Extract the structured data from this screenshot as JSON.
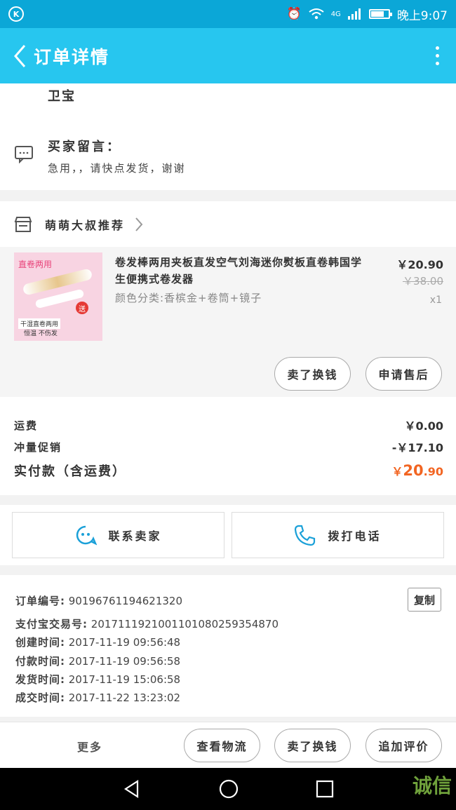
{
  "status_bar": {
    "time": "晚上9:07",
    "network": "4G"
  },
  "nav": {
    "title": "订单详情"
  },
  "address": {
    "name": "卫宝"
  },
  "buyer_message": {
    "title": "买家留言：",
    "text": "急用，，请快点发货，谢谢"
  },
  "shop": {
    "name": "萌萌大叔推荐"
  },
  "item": {
    "title": "卷发棒两用夹板直发空气刘海迷你熨板直卷韩国学生便携式卷发器",
    "sku": "颜色分类:香槟金+卷筒+镜子",
    "price": "￥20.90",
    "original_price": "￥38.00",
    "quantity": "x1",
    "image_label": "直卷两用",
    "image_caption1": "干湿直卷两用",
    "image_caption2": "恒温 不伤发",
    "buttons": [
      "卖了换钱",
      "申请售后"
    ]
  },
  "fees": {
    "shipping_label": "运费",
    "shipping_value": "￥0.00",
    "promo_label": "冲量促销",
    "promo_value": "-￥17.10",
    "total_label": "实付款（含运费）",
    "total_symbol": "￥",
    "total_int": "20",
    "total_dec": ".90"
  },
  "contact": {
    "seller_label": "联系卖家",
    "phone_label": "拨打电话"
  },
  "order_info": {
    "copy_label": "复制",
    "lines": [
      {
        "key": "订单编号:",
        "value": "90196761194621320"
      },
      {
        "key": "支付宝交易号:",
        "value": "2017111921001101080259354870"
      },
      {
        "key": "创建时间:",
        "value": "2017-11-19 09:56:48"
      },
      {
        "key": "付款时间:",
        "value": "2017-11-19 09:56:58"
      },
      {
        "key": "发货时间:",
        "value": "2017-11-19 15:06:58"
      },
      {
        "key": "成交时间:",
        "value": "2017-11-22 13:23:02"
      }
    ]
  },
  "action_bar": {
    "more_label": "更多",
    "buttons": [
      "查看物流",
      "卖了换钱",
      "追加评价"
    ]
  },
  "watermark": "诚信",
  "colors": {
    "status_bar": "#0ba7d7",
    "nav_bar": "#27c6ef",
    "total_price": "#f26522",
    "contact_icon": "#1aa0d8"
  }
}
